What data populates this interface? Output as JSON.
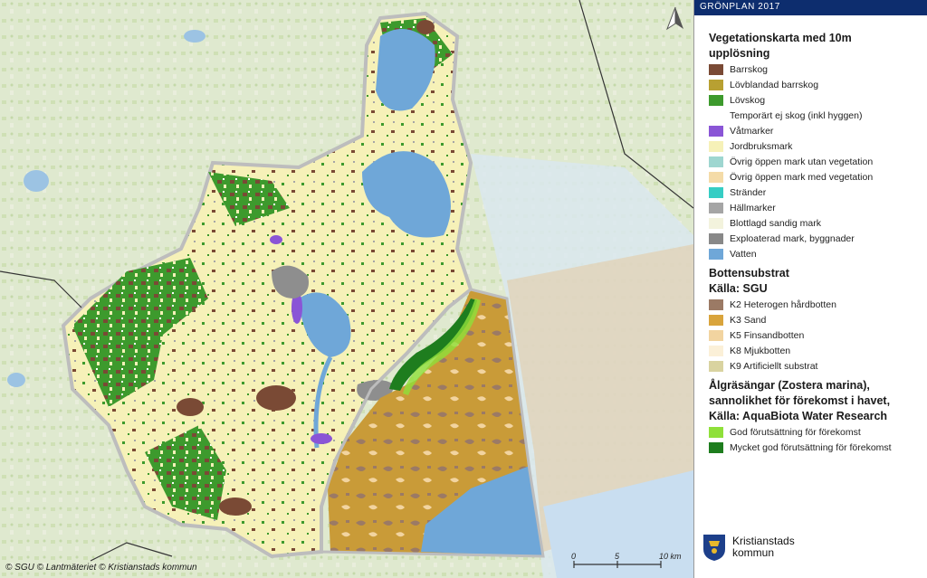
{
  "legend": {
    "header": "GRÖNPLAN 2017",
    "vegetation": {
      "title": "Vegetationskarta med 10m upplösning",
      "items": [
        {
          "label": "Barrskog",
          "color": "#7a4a35"
        },
        {
          "label": "Lövblandad barrskog",
          "color": "#b8a032"
        },
        {
          "label": "Lövskog",
          "color": "#3d9a2d"
        },
        {
          "label": "Temporärt ej skog (inkl hyggen)",
          "color": "#ffffff"
        },
        {
          "label": "Våtmarker",
          "color": "#8a55d6"
        },
        {
          "label": "Jordbruksmark",
          "color": "#f6f1b8"
        },
        {
          "label": "Övrig öppen mark utan vegetation",
          "color": "#9ed6d0"
        },
        {
          "label": "Övrig öppen mark med vegetation",
          "color": "#f4dba8"
        },
        {
          "label": "Stränder",
          "color": "#36cdc4"
        },
        {
          "label": "Hällmarker",
          "color": "#a5a5a5"
        },
        {
          "label": "Blottlagd sandig mark",
          "color": "#f3f3dd"
        },
        {
          "label": "Exploaterad mark, byggnader",
          "color": "#888888"
        },
        {
          "label": "Vatten",
          "color": "#6fa7d8"
        }
      ]
    },
    "substrate": {
      "title": "Bottensubstrat",
      "source": "Källa: SGU",
      "items": [
        {
          "label": "K2 Heterogen hårdbotten",
          "color": "#9b7a65"
        },
        {
          "label": "K3 Sand",
          "color": "#d9a43c"
        },
        {
          "label": "K5 Finsandbotten",
          "color": "#f2d4a0"
        },
        {
          "label": "K8 Mjukbotten",
          "color": "#fbf0d8"
        },
        {
          "label": "K9 Artificiellt substrat",
          "color": "#d9d3a0"
        }
      ]
    },
    "eelgrass": {
      "title_line1": "Ålgräsängar (Zostera marina),",
      "title_line2": "sannolikhet för förekomst i havet,",
      "source": "Källa: AquaBiota Water Research",
      "items": [
        {
          "label": "God förutsättning för förekomst",
          "color": "#8fe03a"
        },
        {
          "label": "Mycket god förutsättning för förekomst",
          "color": "#1e7d1e"
        }
      ]
    },
    "logo": {
      "line1": "Kristianstads",
      "line2": "kommun"
    }
  },
  "map": {
    "credits": "© SGU © Lantmäteriet  © Kristianstads kommun",
    "scale": {
      "labels": [
        "0",
        "5",
        "10 km"
      ]
    },
    "north_icon": "north-arrow-icon"
  }
}
